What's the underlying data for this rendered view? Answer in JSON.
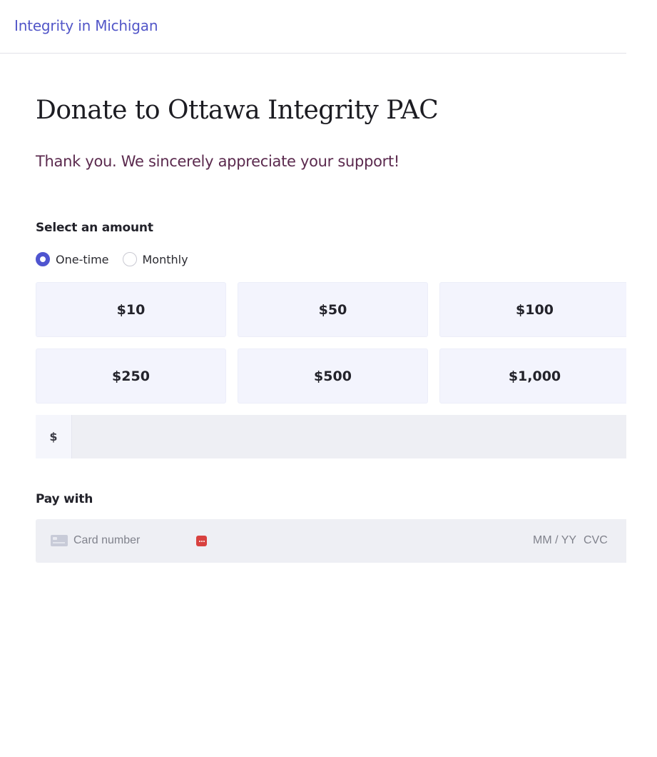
{
  "header": {
    "brand": "Integrity in Michigan"
  },
  "page": {
    "title": "Donate to Ottawa Integrity PAC",
    "thanks": "Thank you. We sincerely appreciate your support!"
  },
  "amount": {
    "label": "Select an amount",
    "frequency": {
      "selected": "One-time",
      "options": [
        "One-time",
        "Monthly"
      ]
    },
    "presets": [
      "$10",
      "$50",
      "$100",
      "$250",
      "$500",
      "$1,000"
    ],
    "custom": {
      "prefix": "$",
      "value": ""
    }
  },
  "payment": {
    "label": "Pay with",
    "card_placeholder": "Card number",
    "expiry_placeholder": "MM / YY",
    "cvc_placeholder": "CVC"
  },
  "colors": {
    "accent": "#4f55d0",
    "brand_link": "#5256c8",
    "thanks_text": "#5b2a4e",
    "preset_bg": "#f3f4fd",
    "input_bg": "#eeeff4",
    "autofill_icon": "#d8413f"
  },
  "icons": {
    "card": "credit-card-icon",
    "autofill": "autofill-icon"
  }
}
